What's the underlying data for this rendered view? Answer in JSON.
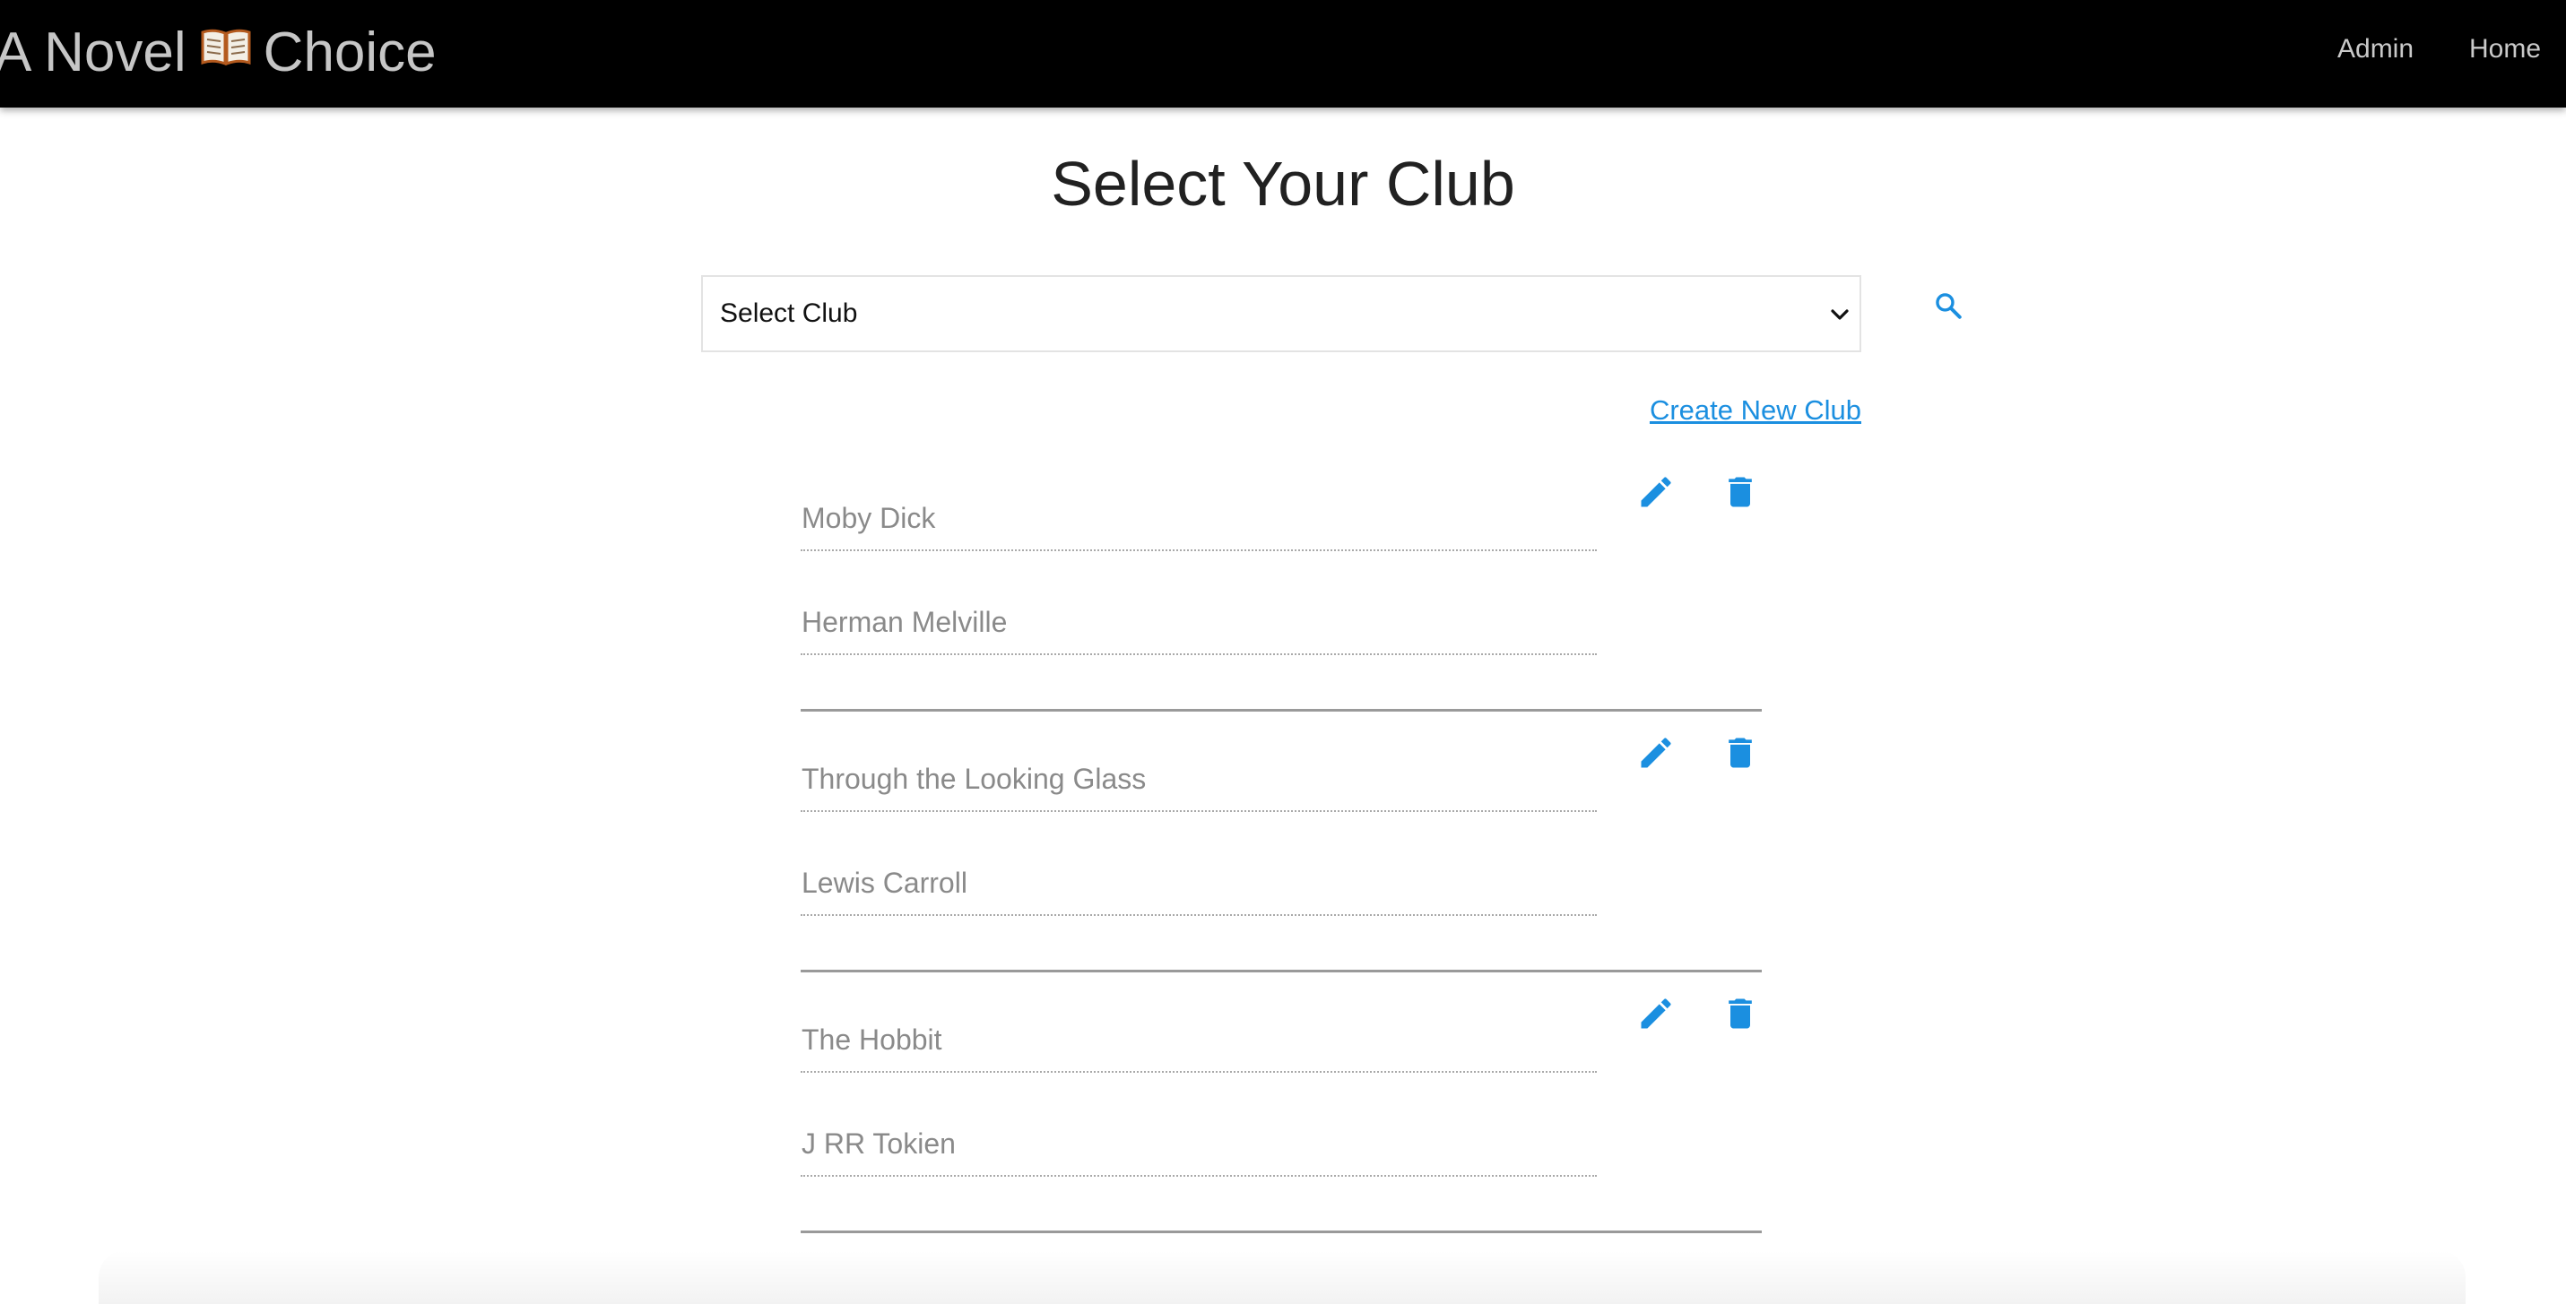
{
  "app": {
    "brand_text_before": "A Novel",
    "brand_text_after": "Choice",
    "brand_icon": "open-book-icon"
  },
  "nav": {
    "links": [
      {
        "label": "Admin"
      },
      {
        "label": "Home"
      }
    ]
  },
  "main": {
    "title": "Select Your Club",
    "club_select": {
      "selected": "Select Club"
    },
    "search_icon": "search-icon",
    "create_link": "Create New Club"
  },
  "books": [
    {
      "title": "Moby Dick",
      "author": "Herman Melville"
    },
    {
      "title": "Through the Looking Glass",
      "author": "Lewis Carroll"
    },
    {
      "title": "The Hobbit",
      "author": "J RR Tokien"
    }
  ],
  "colors": {
    "accent": "#1b8fe0",
    "navbar": "#000000",
    "muted_text": "#8a8a8a"
  }
}
